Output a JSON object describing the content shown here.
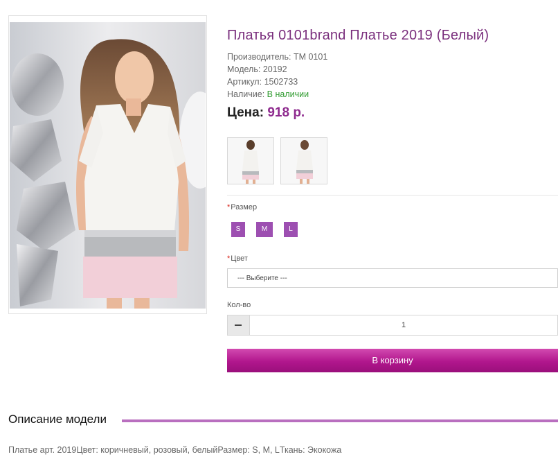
{
  "product": {
    "title": "Платья 0101brand Платье 2019 (Белый)",
    "manufacturer_label": "Производитель:",
    "manufacturer": "TM 0101",
    "model_label": "Модель:",
    "model": "20192",
    "sku_label": "Артикул:",
    "sku": "1502733",
    "availability_label": "Наличие:",
    "availability": "В наличии",
    "price_label": "Цена:",
    "price": "918 р."
  },
  "options": {
    "size_label": "Размер",
    "sizes": [
      "S",
      "M",
      "L"
    ],
    "color_label": "Цвет",
    "color_select": "--- Выберите ---",
    "qty_label": "Кол-во",
    "qty_value": "1"
  },
  "cart_button": "В корзину",
  "description": {
    "heading": "Описание модели",
    "text": "Платье арт. 2019Цвет: коричневый, розовый, белыйРазмер: S, M, LТкань: Экокожа"
  },
  "colors": {
    "title": "#7a2f7d",
    "price": "#8e2a8e",
    "accent": "#9d4fb1",
    "cart": "#b1168d",
    "in_stock": "#2e9a2e"
  }
}
